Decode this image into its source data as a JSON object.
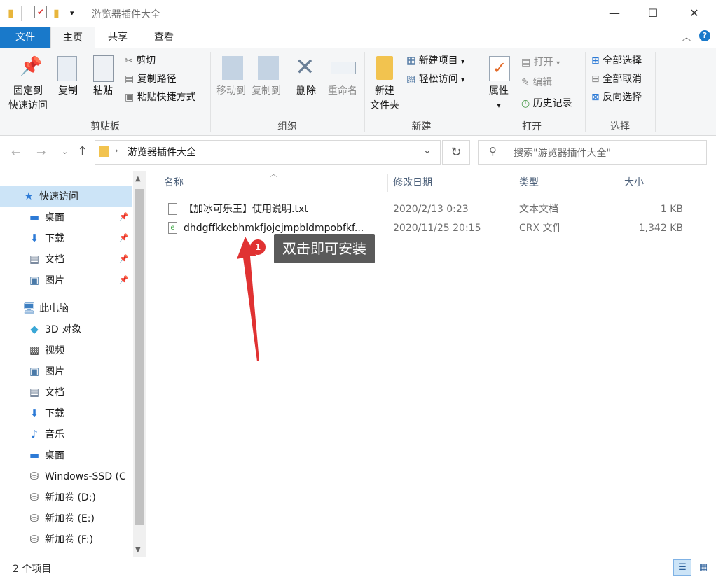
{
  "window": {
    "title": "游览器插件大全",
    "minimize_glyph": "—",
    "maximize_glyph": "☐",
    "close_glyph": "✕"
  },
  "ribbon": {
    "tabs": {
      "file": "文件",
      "home": "主页",
      "share": "共享",
      "view": "查看"
    },
    "groups": {
      "clipboard": {
        "label": "剪贴板",
        "pin_line1": "固定到",
        "pin_line2": "快速访问",
        "copy": "复制",
        "paste": "粘贴",
        "cut": "剪切",
        "copy_path": "复制路径",
        "paste_shortcut": "粘贴快捷方式"
      },
      "organize": {
        "label": "组织",
        "move_to": "移动到",
        "copy_to": "复制到",
        "delete": "删除",
        "rename": "重命名"
      },
      "new": {
        "label": "新建",
        "new_folder_line1": "新建",
        "new_folder_line2": "文件夹",
        "new_item": "新建项目",
        "easy_access": "轻松访问"
      },
      "open": {
        "label": "打开",
        "properties": "属性",
        "open": "打开",
        "edit": "编辑",
        "history": "历史记录"
      },
      "select": {
        "label": "选择",
        "select_all": "全部选择",
        "select_none": "全部取消",
        "invert": "反向选择"
      }
    }
  },
  "address": {
    "path": "游览器插件大全",
    "search_placeholder": "搜索\"游览器插件大全\""
  },
  "nav": {
    "quick_access": "快速访问",
    "qa_items": [
      {
        "label": "桌面"
      },
      {
        "label": "下载"
      },
      {
        "label": "文档"
      },
      {
        "label": "图片"
      }
    ],
    "this_pc": "此电脑",
    "pc_items": [
      {
        "label": "3D 对象"
      },
      {
        "label": "视频"
      },
      {
        "label": "图片"
      },
      {
        "label": "文档"
      },
      {
        "label": "下载"
      },
      {
        "label": "音乐"
      },
      {
        "label": "桌面"
      },
      {
        "label": "Windows-SSD (C"
      },
      {
        "label": "新加卷 (D:)"
      },
      {
        "label": "新加卷 (E:)"
      },
      {
        "label": "新加卷 (F:)"
      }
    ]
  },
  "columns": {
    "name": "名称",
    "modified": "修改日期",
    "type": "类型",
    "size": "大小"
  },
  "files": [
    {
      "name": "【加冰可乐王】使用说明.txt",
      "modified": "2020/2/13 0:23",
      "type": "文本文档",
      "size": "1 KB"
    },
    {
      "name": "dhdgffkkebhmkfjojejmpbldmpobfkf...",
      "modified": "2020/11/25 20:15",
      "type": "CRX 文件",
      "size": "1,342 KB"
    }
  ],
  "annotation": {
    "badge": "1",
    "text": "双击即可安装",
    "color": "#e03232"
  },
  "status": {
    "count": "2 个项目"
  },
  "colors": {
    "accent": "#1979ca",
    "selected_nav": "#cce4f7"
  }
}
